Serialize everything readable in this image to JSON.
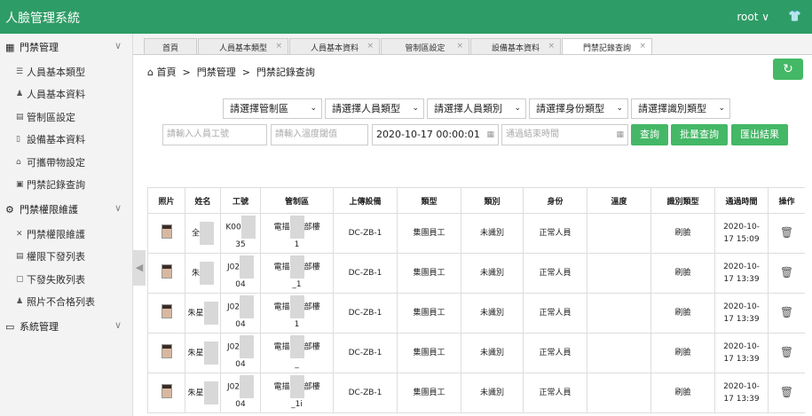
{
  "app": {
    "title": "人臉管理系統",
    "user": "root ∨",
    "shirt_icon": "👕"
  },
  "sidebar": {
    "groups": [
      {
        "label": "門禁管理",
        "icon": "▦",
        "items": [
          {
            "label": "人員基本類型",
            "icon": "☰"
          },
          {
            "label": "人員基本資料",
            "icon": "♟"
          },
          {
            "label": "管制區設定",
            "icon": "▤"
          },
          {
            "label": "設備基本資料",
            "icon": "▯"
          },
          {
            "label": "可攜帶物設定",
            "icon": "⌂"
          },
          {
            "label": "門禁記錄查詢",
            "icon": "▣"
          }
        ]
      },
      {
        "label": "門禁權限維護",
        "icon": "⚙",
        "items": [
          {
            "label": "門禁權限維護",
            "icon": "✕"
          },
          {
            "label": "權限下發列表",
            "icon": "▤"
          },
          {
            "label": "下發失敗列表",
            "icon": "▢"
          },
          {
            "label": "照片不合格列表",
            "icon": "♟"
          }
        ]
      },
      {
        "label": "系統管理",
        "icon": "▭",
        "items": []
      }
    ],
    "collapse_icon": "◀"
  },
  "tabs": [
    "首頁",
    "人員基本類型",
    "人員基本資料",
    "管制區設定",
    "設備基本資料",
    "門禁記錄查詢"
  ],
  "tab_close": "×",
  "breadcrumb": {
    "home_icon": "⌂",
    "home": "首頁",
    "sep": ">",
    "level1": "門禁管理",
    "level2": "門禁記錄查詢"
  },
  "refresh_icon": "↻",
  "filters": {
    "selects": [
      "請選擇管制區",
      "請選擇人員類型",
      "請選擇人員類別",
      "請選擇身份類型",
      "請選擇識別類型"
    ],
    "caret": "⌄",
    "emp_no_placeholder": "請輸入人員工號",
    "temp_placeholder": "請輸入溫度閾值",
    "start_time": "2020-10-17 00:00:01",
    "end_placeholder": "通過結束時間",
    "calendar_icon": "▦",
    "buttons": {
      "query": "查詢",
      "batch": "批量查詢",
      "export": "匯出結果"
    }
  },
  "table": {
    "headers": [
      "照片",
      "姓名",
      "工號",
      "管制區",
      "上傳設備",
      "類型",
      "類別",
      "身份",
      "溫度",
      "識別類型",
      "通過時間",
      "操作"
    ],
    "rows": [
      {
        "name": "全",
        "id1": "K00",
        "id2": "35",
        "zone1": "電描",
        "zone2": "部樓",
        "zone3": "1",
        "device": "DC-ZB-1",
        "type": "集團員工",
        "cat": "未識別",
        "ident": "正常人員",
        "temp": "",
        "rec": "刷臉",
        "date": "2020-10-",
        "time": "17 15:09"
      },
      {
        "name": "朱",
        "id1": "J02",
        "id2": "04",
        "zone1": "電描",
        "zone2": "部樓",
        "zone3": "_1",
        "device": "DC-ZB-1",
        "type": "集團員工",
        "cat": "未識別",
        "ident": "正常人員",
        "temp": "",
        "rec": "刷臉",
        "date": "2020-10-",
        "time": "17 13:39"
      },
      {
        "name": "朱星",
        "id1": "J02",
        "id2": "04",
        "zone1": "電描",
        "zone2": "部樓",
        "zone3": "1",
        "device": "DC-ZB-1",
        "type": "集團員工",
        "cat": "未識別",
        "ident": "正常人員",
        "temp": "",
        "rec": "刷臉",
        "date": "2020-10-",
        "time": "17 13:39"
      },
      {
        "name": "朱星",
        "id1": "J02",
        "id2": "04",
        "zone1": "電描",
        "zone2": "部樓",
        "zone3": "_",
        "device": "DC-ZB-1",
        "type": "集團員工",
        "cat": "未識別",
        "ident": "正常人員",
        "temp": "",
        "rec": "刷臉",
        "date": "2020-10-",
        "time": "17 13:39"
      },
      {
        "name": "朱星",
        "id1": "J02",
        "id2": "04",
        "zone1": "電描",
        "zone2": "部樓",
        "zone3": "_1i",
        "device": "DC-ZB-1",
        "type": "集團員工",
        "cat": "未識別",
        "ident": "正常人員",
        "temp": "",
        "rec": "刷臉",
        "date": "2020-10-",
        "time": "17 13:39"
      }
    ],
    "trash_icon": "🗑"
  }
}
